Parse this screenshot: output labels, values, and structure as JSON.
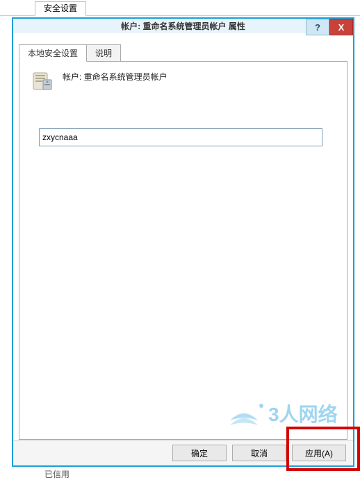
{
  "parent_tab_label": "安全设置",
  "dialog": {
    "title": "帐户: 重命名系统管理员帐户 属性",
    "help_glyph": "?",
    "close_glyph": "X"
  },
  "tabs": {
    "local_security": "本地安全设置",
    "explain": "说明"
  },
  "policy": {
    "label": "帐户: 重命名系统管理员帐户",
    "value": "zxycnaaa"
  },
  "buttons": {
    "ok": "确定",
    "cancel": "取消",
    "apply": "应用(A)"
  },
  "bottom_text": "已信用",
  "watermark_text": "3人网络"
}
